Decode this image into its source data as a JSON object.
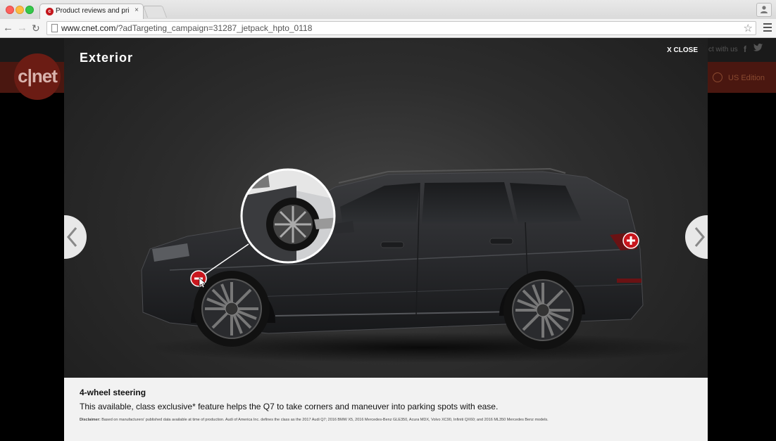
{
  "browser": {
    "tab_title": "Product reviews and prices",
    "tab_close": "×",
    "tab_favicon_letter": "c",
    "url_host": "www.cnet.com",
    "url_path": "/?adTargeting_campaign=31287_jetpack_hpto_0118",
    "star": "☆"
  },
  "background_page": {
    "logo_text": "c|net",
    "connect_text": "ct with us",
    "facebook": "f",
    "twitter": "🐦",
    "edition": "US Edition"
  },
  "modal": {
    "title": "Exterior",
    "close_label": "X CLOSE",
    "feature_title": "4-wheel steering",
    "feature_description": "This available, class exclusive* feature helps the Q7 to take corners and maneuver into parking spots with ease.",
    "disclaimer_label": "Disclaimer:",
    "disclaimer_text": "Based on manufacturers' published data available at time of production. Audi of America Inc. defines the class as the 2017 Audi Q7; 2016 BMW X5, 2016 Mercedes-Benz GLE350, Acura MDX, Volvo XC90, Infiniti QX60; and 2016 ML350 Mercedes Benz models."
  },
  "colors": {
    "hotspot_red": "#c8161d",
    "cnet_red": "#6b1c14",
    "panel_bg": "#f2f2f2"
  }
}
